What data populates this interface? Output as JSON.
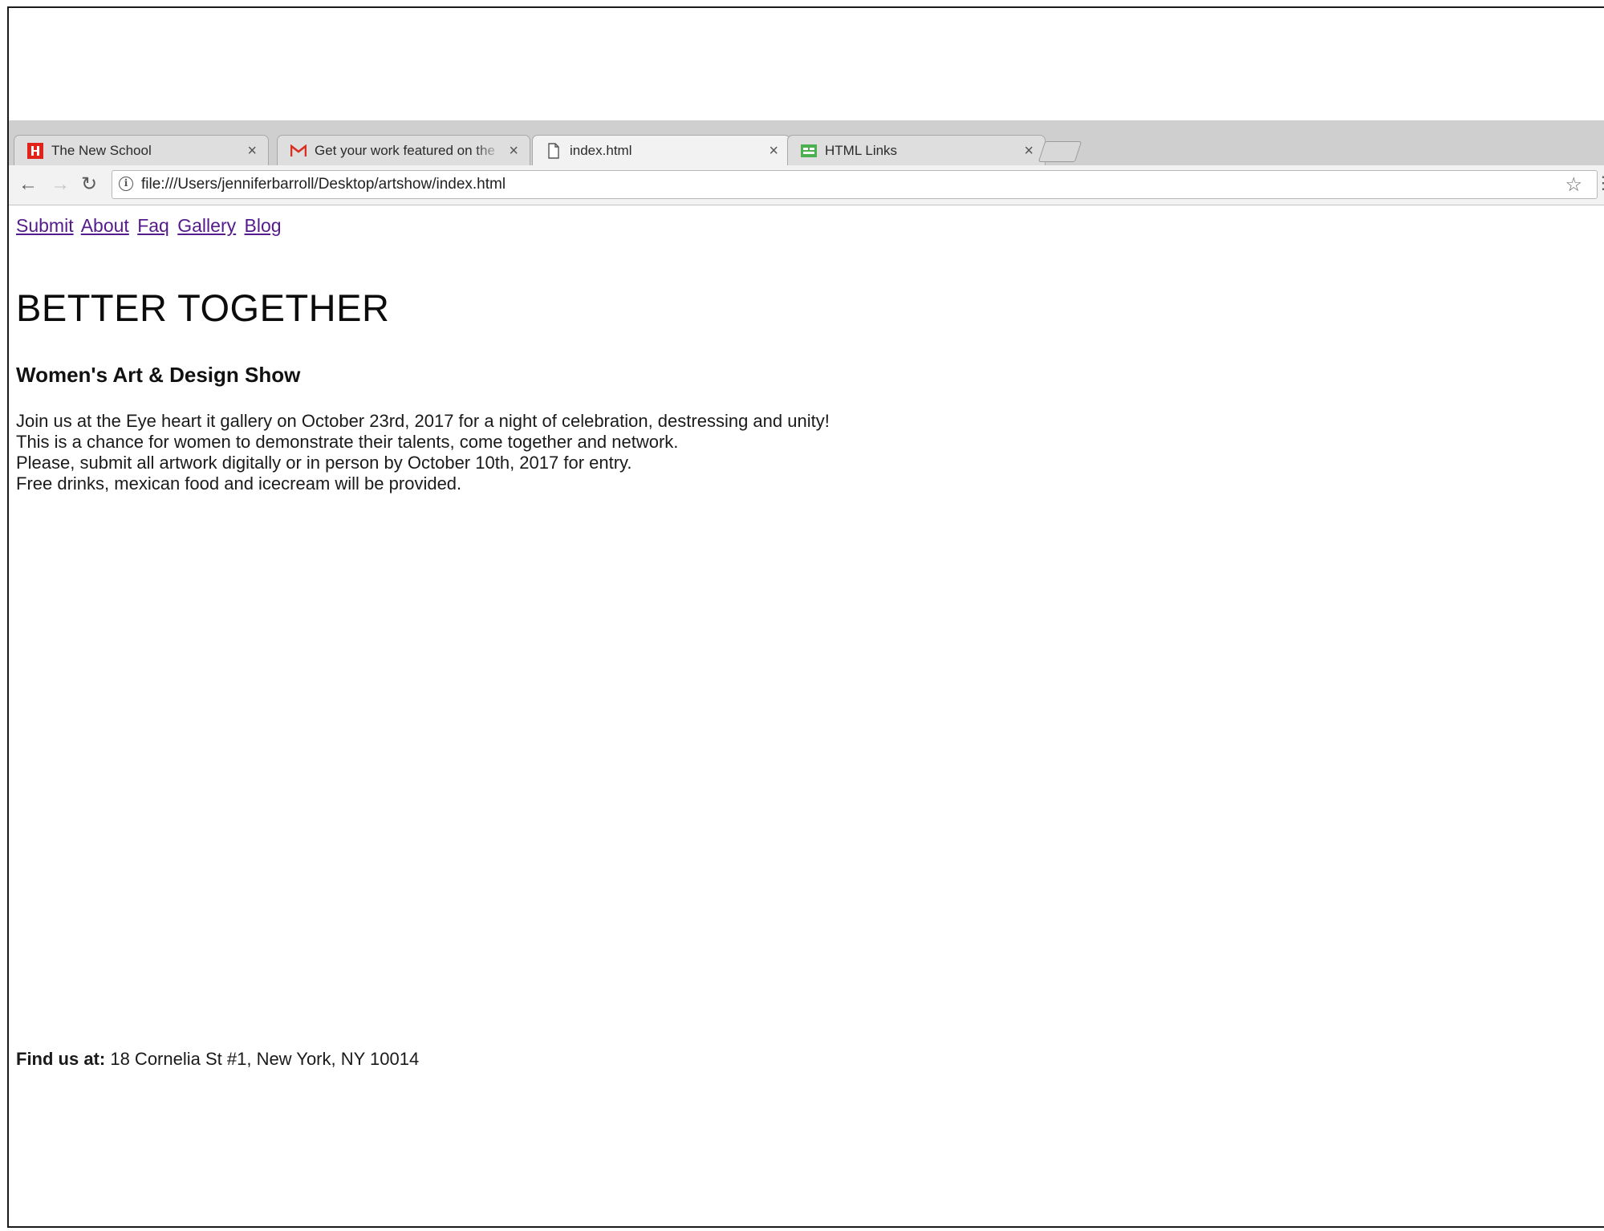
{
  "browser": {
    "tabs": [
      {
        "title": "The New School",
        "favicon": "new-school-favicon",
        "active": false
      },
      {
        "title": "Get your work featured on the",
        "favicon": "gmail-favicon",
        "active": false
      },
      {
        "title": "index.html",
        "favicon": "document-icon",
        "active": true
      },
      {
        "title": "HTML Links",
        "favicon": "w3schools-favicon",
        "active": false
      }
    ],
    "close_glyph": "×",
    "address": "file:///Users/jenniferbarroll/Desktop/artshow/index.html",
    "colors": {
      "new_school_red": "#e2231a",
      "gmail_red": "#d93025",
      "w3_green": "#4caf50",
      "link_visited": "#551a8b"
    }
  },
  "page": {
    "nav": [
      {
        "label": "Submit"
      },
      {
        "label": "About"
      },
      {
        "label": "Faq"
      },
      {
        "label": "Gallery"
      },
      {
        "label": "Blog"
      }
    ],
    "title": "BETTER TOGETHER",
    "subtitle": "Women's Art & Design Show",
    "paragraph_lines": [
      "Join us at the Eye heart it gallery on October 23rd, 2017 for a night of celebration, destressing and unity!",
      "This is a chance for women to demonstrate their talents, come together and network.",
      "Please, submit all artwork digitally or in person by October 10th, 2017 for entry.",
      "Free drinks, mexican food and icecream will be provided."
    ],
    "footer": {
      "label": "Find us at:",
      "address": "18 Cornelia St #1, New York, NY 10014"
    }
  }
}
